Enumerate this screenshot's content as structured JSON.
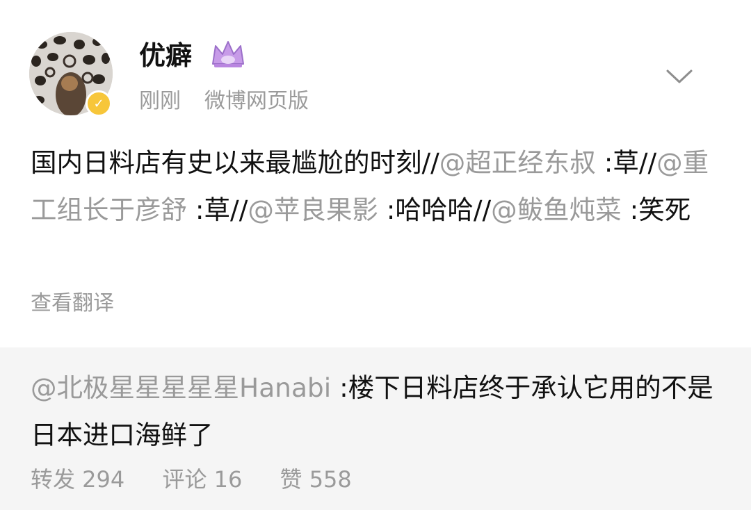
{
  "post": {
    "username": "优癖",
    "time": "刚刚",
    "source": "微博网页版",
    "content": {
      "text_1": "国内日料店有史以来最尴尬的时刻//",
      "mention_1": "@超正经东叔",
      "text_2": " :草//",
      "mention_2": "@重工组长于彦舒",
      "text_3": " :草//",
      "mention_3": "@苹良果影",
      "text_4": " :哈哈哈//",
      "mention_4": "@鲅鱼炖菜",
      "text_5": " :笑死"
    },
    "translate_label": "查看翻译"
  },
  "repost": {
    "mention": "@北极星星星星星Hanabi",
    "text": " :楼下日料店终于承认它用的不是日本进口海鲜了"
  },
  "stats": {
    "repost": "转发 294",
    "comment": "评论 16",
    "like": "赞 558"
  },
  "icons": {
    "avatar": "leopard-avatar",
    "verified": "verified-badge-icon",
    "vip": "crown-icon",
    "menu": "chevron-down-icon"
  },
  "colors": {
    "text": "#111111",
    "muted": "#9a9a9a",
    "repost_bg": "#f5f5f5",
    "verified": "#f7c63a",
    "crown": "#c79be8"
  }
}
